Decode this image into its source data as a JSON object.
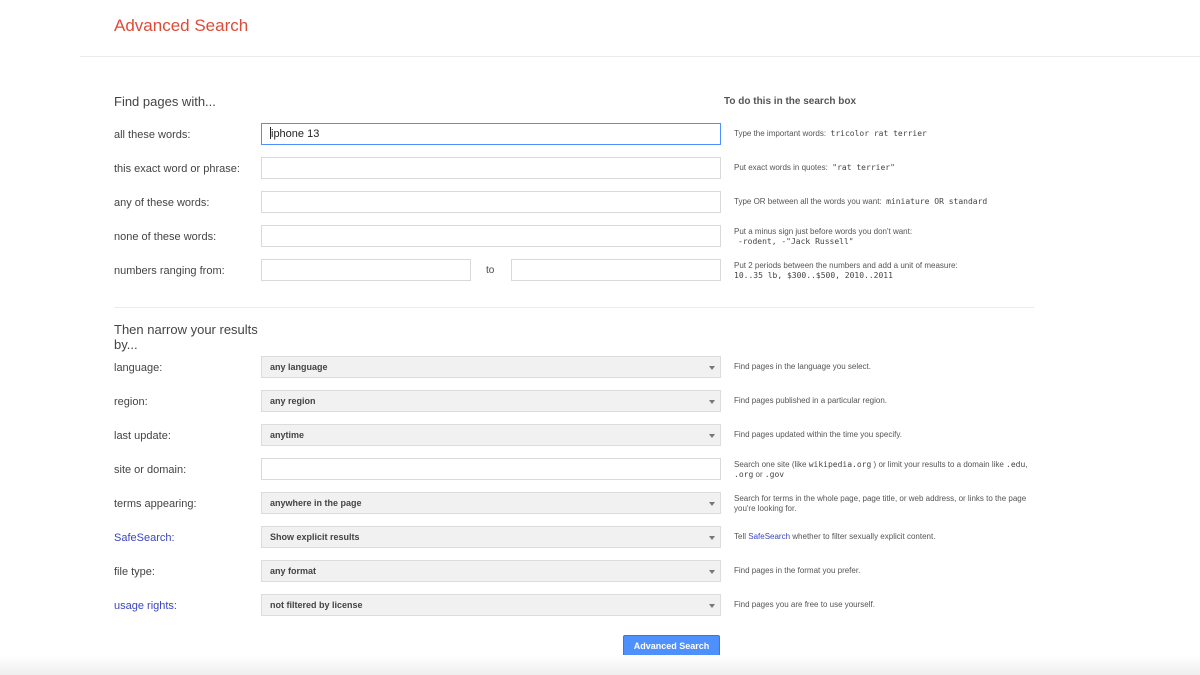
{
  "header": {
    "title": "Advanced Search"
  },
  "find_section": {
    "title": "Find pages with...",
    "side_title": "To do this in the search box",
    "rows": [
      {
        "label": "all these words:",
        "value": "iphone 13",
        "hint_text": "Type the important words:",
        "hint_code": "tricolor rat terrier"
      },
      {
        "label": "this exact word or phrase:",
        "value": "",
        "hint_text": "Put exact words in quotes:",
        "hint_code": "\"rat terrier\""
      },
      {
        "label": "any of these words:",
        "value": "",
        "hint_text": "Type OR between all the words you want:",
        "hint_code": "miniature OR standard"
      },
      {
        "label": "none of these words:",
        "value": "",
        "hint_text": "Put a minus sign just before words you don't want:",
        "hint_code": "-rodent, -\"Jack Russell\""
      },
      {
        "label": "numbers ranging from:",
        "value_from": "",
        "to_label": "to",
        "value_to": "",
        "hint_text": "Put 2 periods between the numbers and add a unit of measure:",
        "hint_code": "10..35 lb, $300..$500, 2010..2011"
      }
    ]
  },
  "narrow_section": {
    "title_line1": "Then narrow your results",
    "title_line2": "by...",
    "rows": [
      {
        "label": "language:",
        "selected": "any language",
        "hint": "Find pages in the language you select."
      },
      {
        "label": "region:",
        "selected": "any region",
        "hint": "Find pages published in a particular region."
      },
      {
        "label": "last update:",
        "selected": "anytime",
        "hint": "Find pages updated within the time you specify."
      },
      {
        "label": "site or domain:",
        "value": "",
        "hint_pre": "Search one site (like ",
        "hint_code1": "wikipedia.org",
        "hint_mid": " ) or limit your results to a domain like ",
        "hint_code2": ".edu",
        "hint_sep1": ", ",
        "hint_code3": ".org",
        "hint_sep2": " or ",
        "hint_code4": ".gov"
      },
      {
        "label": "terms appearing:",
        "selected": "anywhere in the page",
        "hint": "Search for terms in the whole page, page title, or web address, or links to the page you're looking for."
      },
      {
        "label": "SafeSearch:",
        "selected": "Show explicit results",
        "hint_pre": "Tell ",
        "hint_link": "SafeSearch",
        "hint_post": " whether to filter sexually explicit content."
      },
      {
        "label": "file type:",
        "selected": "any format",
        "hint": "Find pages in the format you prefer."
      },
      {
        "label": "usage rights:",
        "selected": "not filtered by license",
        "hint": "Find pages you are free to use yourself."
      }
    ]
  },
  "submit": {
    "label": "Advanced Search"
  },
  "colors": {
    "title_red": "#dd4b39",
    "link_blue": "#3a45c0",
    "button_blue": "#4d90fe",
    "focus_blue": "#4d90fe"
  }
}
